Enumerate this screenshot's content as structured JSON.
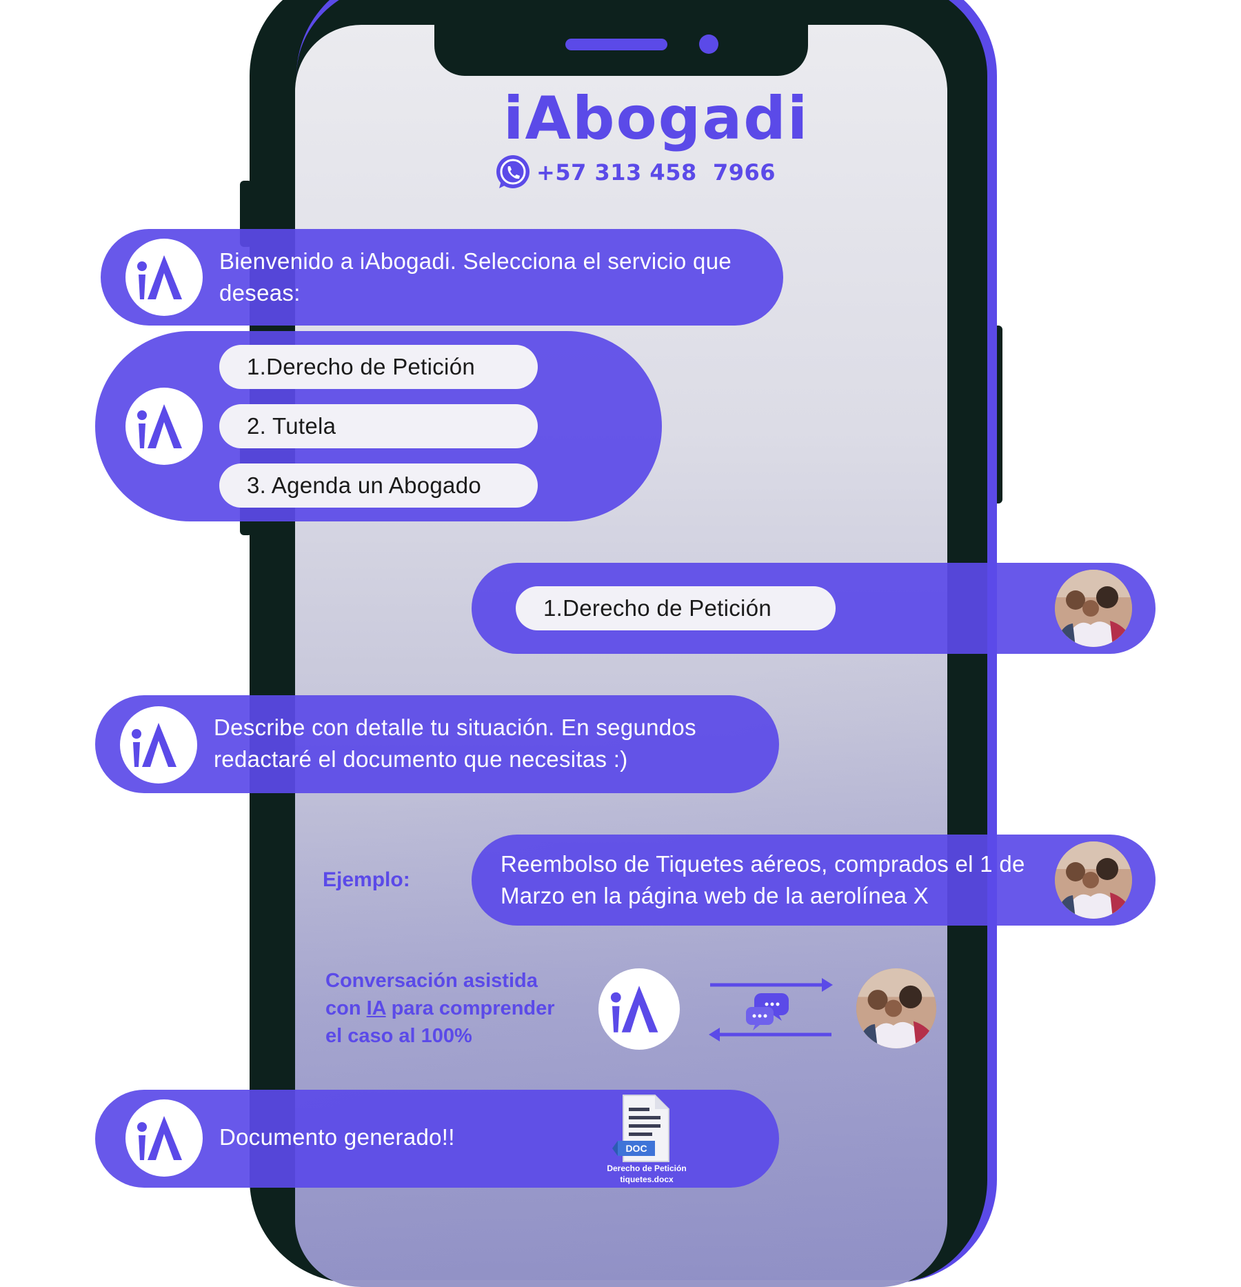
{
  "brand": {
    "logo_text": "iAbogadi",
    "whatsapp_number": "+57 313 458  7966",
    "accent_color": "#5b4ae8",
    "icon": "whatsapp-icon"
  },
  "chat": {
    "welcome": "Bienvenido a iAbogadi. Selecciona el servicio que deseas:",
    "options": [
      "1.Derecho de Petición",
      "2. Tutela",
      "3. Agenda un Abogado"
    ],
    "user_choice": "1.Derecho de Petición",
    "describe_prompt": "Describe con detalle tu situación. En segundos redactaré el documento que necesitas :)",
    "example_label": "Ejemplo:",
    "example_text": "Reembolso de Tiquetes aéreos, comprados el 1 de Marzo en la página web de la aerolínea X",
    "assisted_line1": "Conversación asistida",
    "assisted_con": "con ",
    "assisted_ia": "IA",
    "assisted_rest": " para comprender",
    "assisted_line3": "el caso al 100%",
    "generated": "Documento generado!!",
    "doc_badge": "DOC",
    "doc_name_line1": "Derecho de Petición",
    "doc_name_line2": "tiquetes.docx"
  }
}
